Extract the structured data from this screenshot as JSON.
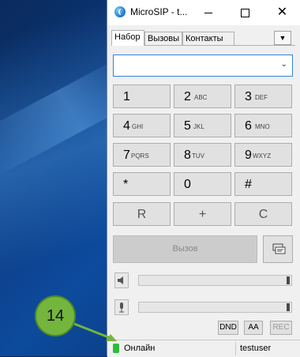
{
  "window": {
    "title": "MicroSIP - t..."
  },
  "tabs": [
    {
      "label": "Набор",
      "active": true
    },
    {
      "label": "Вызовы",
      "active": false
    },
    {
      "label": "Контакты",
      "active": false
    }
  ],
  "dialer": {
    "number_value": "",
    "keys": [
      {
        "digit": "1",
        "letters": ""
      },
      {
        "digit": "2",
        "letters": "ABC"
      },
      {
        "digit": "3",
        "letters": "DEF"
      },
      {
        "digit": "4",
        "letters": "GHI"
      },
      {
        "digit": "5",
        "letters": "JKL"
      },
      {
        "digit": "6",
        "letters": "MNO"
      },
      {
        "digit": "7",
        "letters": "PQRS"
      },
      {
        "digit": "8",
        "letters": "TUV"
      },
      {
        "digit": "9",
        "letters": "WXYZ"
      },
      {
        "digit": "*",
        "letters": ""
      },
      {
        "digit": "0",
        "letters": ""
      },
      {
        "digit": "#",
        "letters": ""
      }
    ],
    "actions": {
      "redial": "R",
      "plus": "+",
      "clear": "C"
    },
    "call_label": "Вызов"
  },
  "buttons": {
    "dnd": "DND",
    "aa": "AA",
    "rec": "REC"
  },
  "status": {
    "text": "Онлайн",
    "user": "testuser",
    "color": "#2cbc3a"
  },
  "annotation": {
    "badge": "14",
    "color": "#74b53e"
  }
}
